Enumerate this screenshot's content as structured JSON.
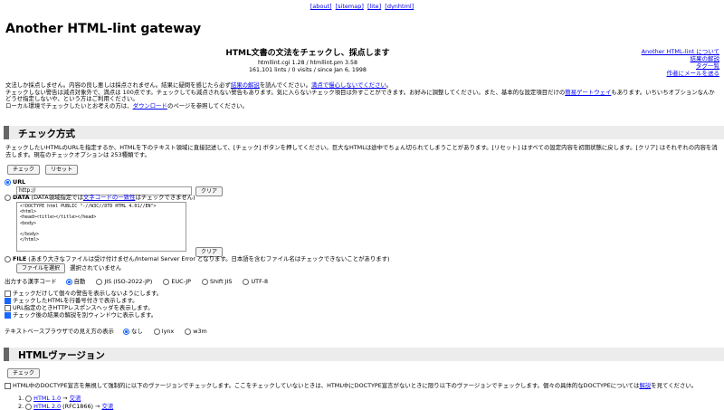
{
  "nav": {
    "about": "[about]",
    "sitemap": "[sitemap]",
    "lite": "[lite]",
    "dynhtml": "[dynhtml]"
  },
  "title": "Another HTML-lint gateway",
  "subtitle": "HTML文書の文法をチェックし、採点します",
  "meta": {
    "line1": "htmllint.cgi 1.28 / htmllint.pm 3.58",
    "line2": "161,101 lints / 0 visits / since Jan 6, 1998"
  },
  "right_links": [
    "Another HTML-lint について",
    "結果の解説",
    "タグ一覧",
    "作者にメールを送る"
  ],
  "intro": {
    "l1_a": "文法しか採点しません。内容の良し悪しは採点されません。結果に疑問を感じたら必ず",
    "l1_link1": "結果の解説",
    "l1_b": "を読んでください。",
    "l1_link2": "満点で慢心しないでください",
    "l1_c": "。",
    "l2_a": "チェックしない警告は減点対象外で、満点は 100点です。チェックしても減点されない警告もあります。気に入らないチェック項目は外すことができます。お好みに調整してください。また、基本的な設定項目だけの",
    "l2_link": "簡易ゲートウェイ",
    "l2_b": "もあります。いちいちオプションなんかどうせ指定しないや、という方はご利用ください。",
    "l3_a": "ローカル環境でチェックしたいとお考えの方は、",
    "l3_link": "ダウンロード",
    "l3_b": "のページを参照してください。"
  },
  "section1": {
    "heading": "チェック方式",
    "desc": "チェックしたいHTMLのURLを指定するか、HTMLを下のテキスト領域に直接記述して、[チェック] ボタンを押してください。巨大なHTMLは途中でちょん切られてしまうことがあります。[リセット] はすべての設定内容を初期状態に戻します。[クリア] はそれぞれの内容を消去します。現在のチェックオプションは 253種類です。",
    "check_btn": "チェック",
    "reset_btn": "リセット",
    "url_label": "URL",
    "url_value": "http://",
    "clear1": "クリア",
    "data_label": "DATA",
    "data_note_a": "(DATA領域指定では",
    "data_note_link": "文字コードの一致性",
    "data_note_b": "はチェックできません)",
    "textarea": "<!DOCTYPE html PUBLIC \"-//W3C//DTD HTML 4.01//EN\">\n<html>\n<head><title></title></head>\n<body>\n\n</body>\n</html>",
    "clear2": "クリア",
    "file_label": "FILE",
    "file_note": "(あまり大きなファイルは受け付けません/Internal Server Error となります。日本語を含むファイル名はチェックできないことがあります)",
    "file_btn": "ファイルを選択",
    "file_status": "選択されていません",
    "charset_label": "出力する漢字コード",
    "charsets": [
      "自動",
      "JIS (ISO-2022-JP)",
      "EUC-JP",
      "Shift JIS",
      "UTF-8"
    ],
    "options": [
      {
        "label": "チェックだけして個々の警告を表示しないようにします。",
        "checked": false
      },
      {
        "label": "チェックしたHTMLを行番号付きで表示します。",
        "checked": true
      },
      {
        "label": "URL指定のときHTTPレスポンスヘッダを表示します。",
        "checked": false
      },
      {
        "label": "チェック後の結果の解説を別ウィンドウに表示します。",
        "checked": true
      }
    ],
    "browser_label": "テキストベースブラウザでの見え方の表示",
    "browsers": [
      "なし",
      "lynx",
      "w3m"
    ]
  },
  "section2": {
    "heading": "HTMLヴァージョン",
    "check_btn": "チェック",
    "desc_a": "HTML中のDOCTYPE宣言を無視して強制的に以下のヴァージョンでチェックします。ここをチェックしていないときは、HTML中にDOCTYPE宣言がないときに限り以下のヴァージョンでチェックします。個々の具体的なDOCTYPEについては",
    "desc_link": "解説",
    "desc_b": "を見てください。",
    "versions": [
      {
        "num": "1.",
        "name": "HTML 1.0",
        "arrow": " → ",
        "link": "交流"
      },
      {
        "num": "2.",
        "name": "HTML 2.0",
        "extra": " (RFC1866)",
        "arrow": " → ",
        "link": "交流"
      }
    ]
  }
}
